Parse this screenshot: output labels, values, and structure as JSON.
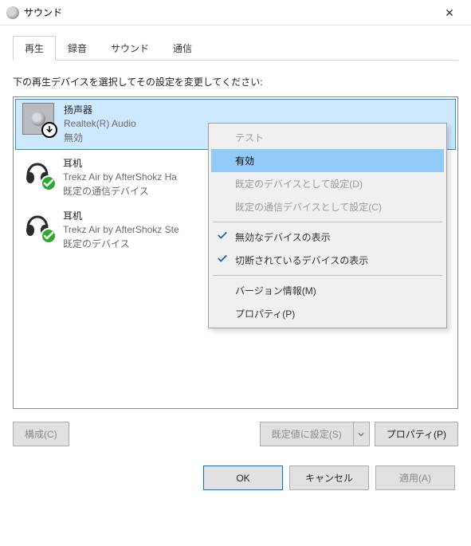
{
  "window": {
    "title": "サウンド"
  },
  "tabs": [
    {
      "label": "再生",
      "active": true
    },
    {
      "label": "録音"
    },
    {
      "label": "サウンド"
    },
    {
      "label": "通信"
    }
  ],
  "instruction": "下の再生デバイスを選択してその設定を変更してください:",
  "devices": [
    {
      "title": "扬声器",
      "subtitle": "Realtek(R) Audio",
      "status": "無効",
      "iconType": "speaker",
      "overlay": "disabled-arrow",
      "selected": true
    },
    {
      "title": "耳机",
      "subtitle": "Trekz Air by AfterShokz Ha",
      "status": "既定の通信デバイス",
      "iconType": "headset",
      "overlay": "check-green"
    },
    {
      "title": "耳机",
      "subtitle": "Trekz Air by AfterShokz Ste",
      "status": "既定のデバイス",
      "iconType": "headset",
      "overlay": "check-green"
    }
  ],
  "context_menu": {
    "items": [
      {
        "label": "テスト",
        "type": "item",
        "disabled": true
      },
      {
        "label": "有効",
        "type": "item",
        "highlight": true
      },
      {
        "label": "既定のデバイスとして設定(D)",
        "type": "item",
        "disabled": true
      },
      {
        "label": "既定の通信デバイスとして設定(C)",
        "type": "item",
        "disabled": true
      },
      {
        "type": "sep"
      },
      {
        "label": "無効なデバイスの表示",
        "type": "item",
        "checked": true
      },
      {
        "label": "切断されているデバイスの表示",
        "type": "item",
        "checked": true
      },
      {
        "type": "sep"
      },
      {
        "label": "バージョン情報(M)",
        "type": "item"
      },
      {
        "label": "プロパティ(P)",
        "type": "item"
      }
    ]
  },
  "controls": {
    "configure": "構成(C)",
    "set_default": "既定値に設定(S)",
    "properties": "プロパティ(P)"
  },
  "dialog_buttons": {
    "ok": "OK",
    "cancel": "キャンセル",
    "apply": "適用(A)"
  }
}
